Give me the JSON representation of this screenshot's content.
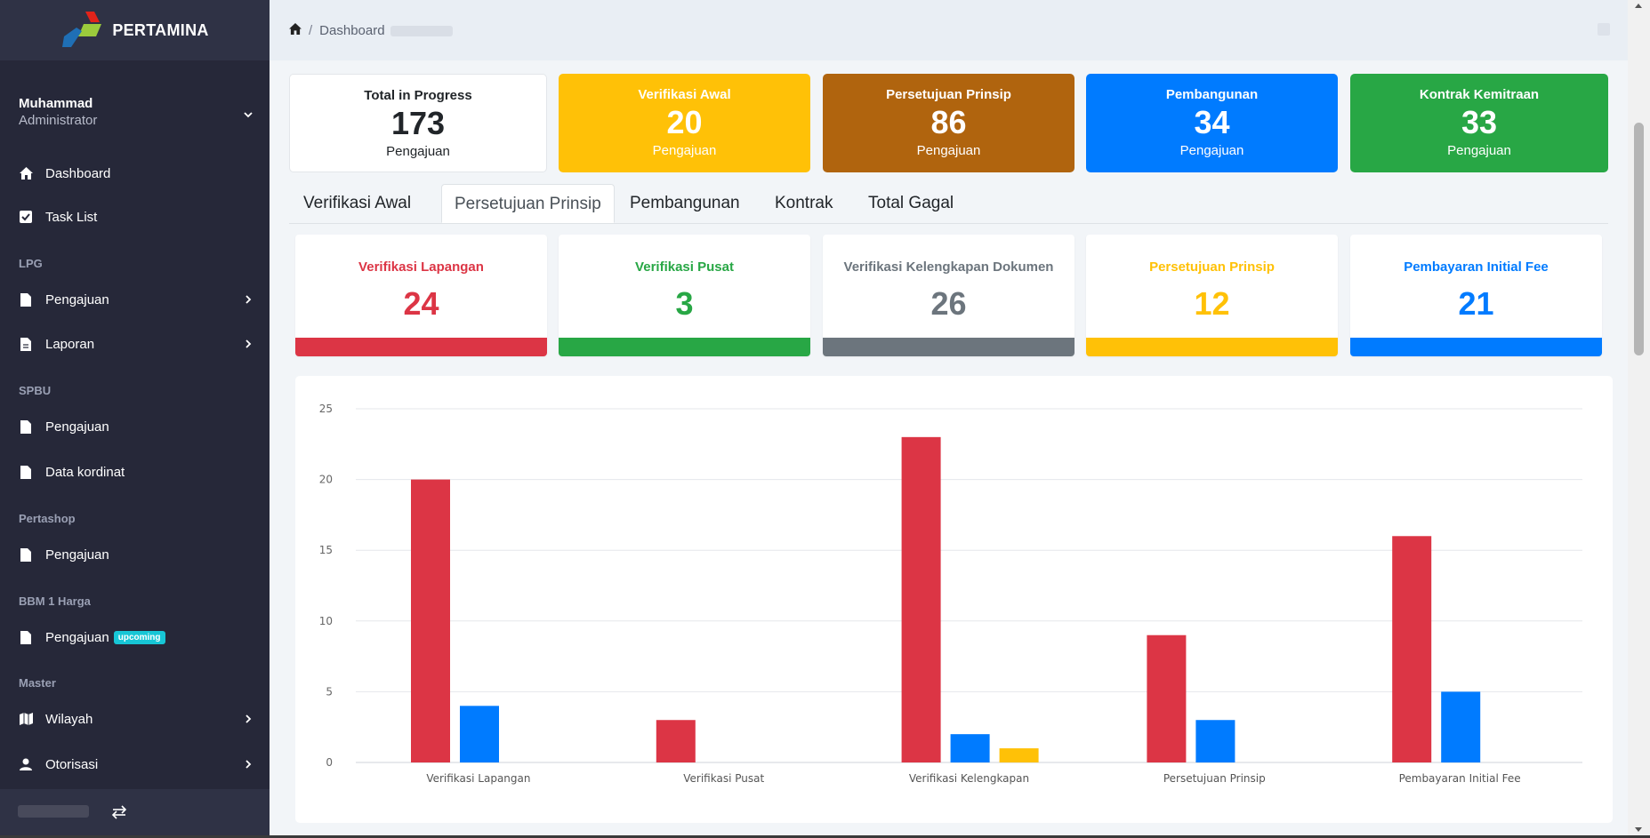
{
  "brand": {
    "name": "PERTAMINA"
  },
  "user": {
    "name": "Muhammad",
    "role": "Administrator"
  },
  "sidebar": {
    "dashboard": "Dashboard",
    "task_list": "Task List",
    "sections": {
      "lpg": "LPG",
      "spbu": "SPBU",
      "pertashop": "Pertashop",
      "bbm": "BBM 1 Harga",
      "master": "Master"
    },
    "lpg_pengajuan": "Pengajuan",
    "lpg_laporan": "Laporan",
    "spbu_pengajuan": "Pengajuan",
    "spbu_data_kordinat": "Data kordinat",
    "pertashop_pengajuan": "Pengajuan",
    "bbm_pengajuan": "Pengajuan",
    "bbm_badge": "upcoming",
    "master_wilayah": "Wilayah",
    "master_otorisasi": "Otorisasi"
  },
  "breadcrumb": {
    "sep": "/",
    "current": "Dashboard"
  },
  "stats": [
    {
      "title": "Total in Progress",
      "value": "173",
      "sub": "Pengajuan",
      "color": "#ffffff"
    },
    {
      "title": "Verifikasi Awal",
      "value": "20",
      "sub": "Pengajuan",
      "color": "#ffc107"
    },
    {
      "title": "Persetujuan Prinsip",
      "value": "86",
      "sub": "Pengajuan",
      "color": "#b0640e"
    },
    {
      "title": "Pembangunan",
      "value": "34",
      "sub": "Pengajuan",
      "color": "#007bff"
    },
    {
      "title": "Kontrak Kemitraan",
      "value": "33",
      "sub": "Pengajuan",
      "color": "#28a745"
    }
  ],
  "tabs": [
    {
      "label": "Verifikasi Awal"
    },
    {
      "label": "Persetujuan Prinsip"
    },
    {
      "label": "Pembangunan"
    },
    {
      "label": "Kontrak"
    },
    {
      "label": "Total Gagal"
    }
  ],
  "active_tab": "Persetujuan Prinsip",
  "sub_stats": [
    {
      "title": "Verifikasi Lapangan",
      "value": "24",
      "color": "#dc3545"
    },
    {
      "title": "Verifikasi Pusat",
      "value": "3",
      "color": "#28a745"
    },
    {
      "title": "Verifikasi Kelengkapan Dokumen",
      "value": "26",
      "color": "#6c757d"
    },
    {
      "title": "Persetujuan Prinsip",
      "value": "12",
      "color": "#ffc107"
    },
    {
      "title": "Pembayaran Initial Fee",
      "value": "21",
      "color": "#007bff"
    }
  ],
  "chart_data": {
    "type": "bar",
    "categories": [
      "Verifikasi Lapangan",
      "Verifikasi Pusat",
      "Verifikasi Kelengkapan",
      "Persetujuan Prinsip",
      "Pembayaran Initial Fee"
    ],
    "series": [
      {
        "values": [
          20,
          3,
          23,
          9,
          16
        ],
        "color": "#dc3545"
      },
      {
        "values": [
          4,
          0,
          2,
          3,
          5
        ],
        "color": "#007bff"
      },
      {
        "values": [
          0,
          0,
          1,
          0,
          0
        ],
        "color": "#ffc107"
      }
    ],
    "ylim": [
      0,
      25
    ],
    "yticks": [
      0,
      5,
      10,
      15,
      20,
      25
    ],
    "grid": true,
    "legend": "none"
  }
}
